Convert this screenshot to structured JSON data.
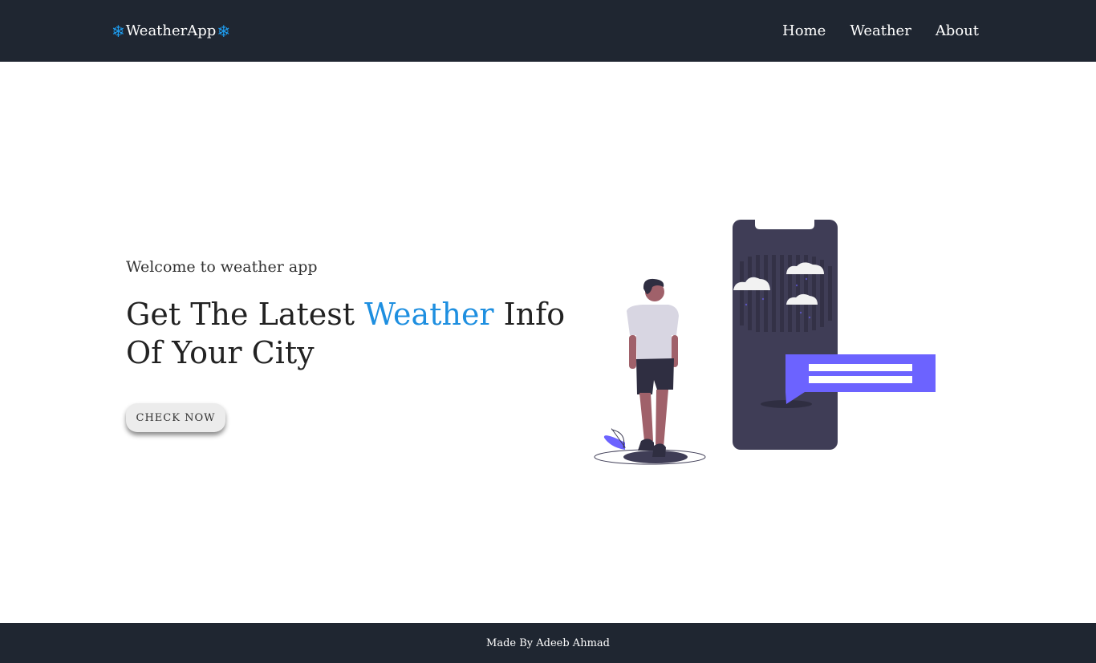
{
  "navbar": {
    "brand_icon_left": "❄",
    "brand": "WeatherApp",
    "brand_icon_right": "❄",
    "links": [
      {
        "label": "Home"
      },
      {
        "label": "Weather"
      },
      {
        "label": "About"
      }
    ]
  },
  "hero": {
    "subtitle": "Welcome to weather app",
    "title_before": "Get The Latest ",
    "title_accent": "Weather",
    "title_after": " Info Of Your City",
    "button_label": "CHECK NOW"
  },
  "illustration": {
    "icon": "person-with-phone-weather-illustration"
  },
  "footer": {
    "text": "Made By Adeeb Ahmad"
  },
  "colors": {
    "nav_bg": "#1f2631",
    "accent": "#1e8fe0",
    "phone": "#3f3d56",
    "bubble": "#6c63ff"
  }
}
